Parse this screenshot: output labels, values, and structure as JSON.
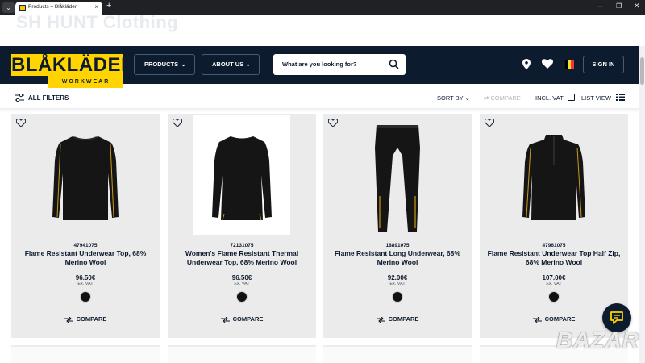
{
  "browser": {
    "tab_title": "Products – Blåkläder",
    "new_tab": "+",
    "dropdown": "⌄",
    "close_tab": "×",
    "win_min": "–",
    "win_max": "❐",
    "win_close": "✕"
  },
  "watermark": "SH HUNT Clothing",
  "header": {
    "logo_top": "BLÅKLÄDER",
    "logo_bottom": "WORKWEAR",
    "nav": [
      {
        "label": "PRODUCTS"
      },
      {
        "label": "ABOUT US"
      }
    ],
    "search_placeholder": "What are you looking for?",
    "signin": "SIGN IN",
    "flag_colors": [
      "#000000",
      "#fdda24",
      "#ef3340"
    ]
  },
  "filters": {
    "all_filters": "ALL FILTERS",
    "sort_by": "SORT BY",
    "compare": "COMPARE",
    "incl_vat": "INCL. VAT",
    "list_view": "LIST VIEW"
  },
  "products": [
    {
      "sku": "47941075",
      "name": "Flame Resistant Underwear Top, 68% Merino Wool",
      "price": "96.50€",
      "vat_note": "Ex. VAT",
      "compare": "COMPARE",
      "garment": "top"
    },
    {
      "sku": "72131075",
      "name": "Women's Flame Resistant Thermal Underwear Top, 68% Merino Wool",
      "price": "96.50€",
      "vat_note": "Ex. VAT",
      "compare": "COMPARE",
      "garment": "womens-top"
    },
    {
      "sku": "18891075",
      "name": "Flame Resistant Long Underwear, 68% Merino Wool",
      "price": "92.00€",
      "vat_note": "Ex. VAT",
      "compare": "COMPARE",
      "garment": "leggings"
    },
    {
      "sku": "47961075",
      "name": "Flame Resistant Underwear Top Half Zip, 68% Merino Wool",
      "price": "107.00€",
      "vat_note": "Ex. VAT",
      "compare": "COMPARE",
      "garment": "half-zip"
    }
  ],
  "colors": {
    "navy": "#0d1b2e",
    "brand_yellow": "#ffd400",
    "card_bg": "#ebebeb"
  },
  "bazar_watermark": "BAZAR"
}
